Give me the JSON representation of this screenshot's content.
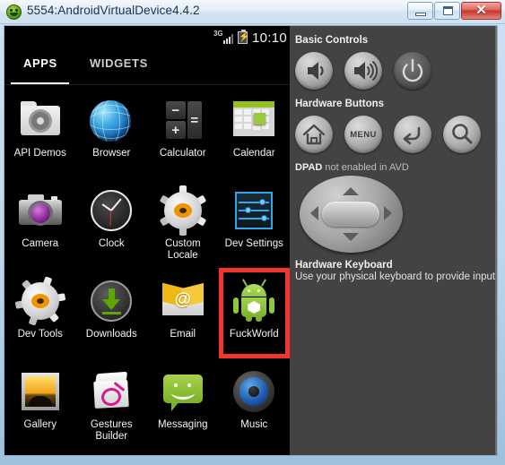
{
  "window": {
    "title": "5554:AndroidVirtualDevice4.4.2",
    "icon": "android-head-icon",
    "controls": {
      "minimize_label": "minimize-icon",
      "maximize_label": "maximize-icon",
      "close_label": "✕"
    }
  },
  "device": {
    "statusbar": {
      "network": "3G",
      "signal_icon": "signal-bars-icon",
      "battery_icon": "battery-charging-icon",
      "battery_glyph": "⚡",
      "time": "10:10"
    },
    "tabs": [
      {
        "label": "APPS",
        "active": true
      },
      {
        "label": "WIDGETS",
        "active": false
      }
    ],
    "apps": [
      {
        "label": "API Demos",
        "icon": "api-demos-icon",
        "highlighted": false
      },
      {
        "label": "Browser",
        "icon": "browser-icon",
        "highlighted": false
      },
      {
        "label": "Calculator",
        "icon": "calculator-icon",
        "highlighted": false
      },
      {
        "label": "Calendar",
        "icon": "calendar-icon",
        "highlighted": false
      },
      {
        "label": "Camera",
        "icon": "camera-icon",
        "highlighted": false
      },
      {
        "label": "Clock",
        "icon": "clock-icon",
        "highlighted": false
      },
      {
        "label": "Custom Locale",
        "icon": "custom-locale-icon",
        "highlighted": false
      },
      {
        "label": "Dev Settings",
        "icon": "dev-settings-icon",
        "highlighted": false
      },
      {
        "label": "Dev Tools",
        "icon": "dev-tools-icon",
        "highlighted": false
      },
      {
        "label": "Downloads",
        "icon": "downloads-icon",
        "highlighted": false
      },
      {
        "label": "Email",
        "icon": "email-icon",
        "highlighted": false
      },
      {
        "label": "FuckWorld",
        "icon": "android-app-icon",
        "highlighted": true
      },
      {
        "label": "Gallery",
        "icon": "gallery-icon",
        "highlighted": false
      },
      {
        "label": "Gestures Builder",
        "icon": "gestures-builder-icon",
        "highlighted": false
      },
      {
        "label": "Messaging",
        "icon": "messaging-icon",
        "highlighted": false
      },
      {
        "label": "Music",
        "icon": "music-icon",
        "highlighted": false
      }
    ]
  },
  "panel": {
    "basic_controls_heading": "Basic Controls",
    "basic_buttons": [
      {
        "label": "volume-down-icon"
      },
      {
        "label": "volume-up-icon"
      },
      {
        "label": "power-icon"
      }
    ],
    "hardware_buttons_heading": "Hardware Buttons",
    "hardware_buttons": [
      {
        "label": "home-icon",
        "text": ""
      },
      {
        "label": "menu-button",
        "text": "MENU"
      },
      {
        "label": "back-icon",
        "text": ""
      },
      {
        "label": "search-icon",
        "text": ""
      }
    ],
    "dpad_label_strong": "DPAD",
    "dpad_label_rest": " not enabled in AVD",
    "keyboard_title": "Hardware Keyboard",
    "keyboard_subtitle": "Use your physical keyboard to provide input"
  },
  "colors": {
    "highlight": "#f5342c",
    "android_green": "#8dc63f",
    "panel_bg": "#434343",
    "screen_bg": "#000000",
    "accent_blue": "#2fa8e8"
  }
}
